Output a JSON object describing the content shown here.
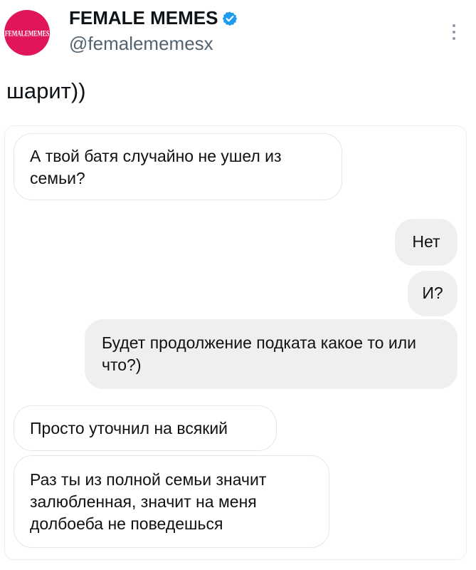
{
  "post": {
    "avatar_text": "FEMALEMEMES",
    "display_name": "FEMALE MEMES",
    "handle": "@femalememesx",
    "text": "шарит))",
    "verified_color": "#1d9bf0",
    "avatar_color": "#e0155a"
  },
  "chat": {
    "messages": [
      {
        "side": "incoming",
        "text": "А твой батя случайно не ушел из семьи?"
      },
      {
        "side": "outgoing",
        "text": "Нет"
      },
      {
        "side": "outgoing",
        "text": "И?"
      },
      {
        "side": "outgoing",
        "text": "Будет продолжение подката какое то или что?)"
      },
      {
        "side": "incoming",
        "text": "Просто уточнил на всякий"
      },
      {
        "side": "incoming",
        "text": "Раз ты из полной семьи значит залюбленная, значит на меня долбоеба не поведешься"
      }
    ]
  }
}
